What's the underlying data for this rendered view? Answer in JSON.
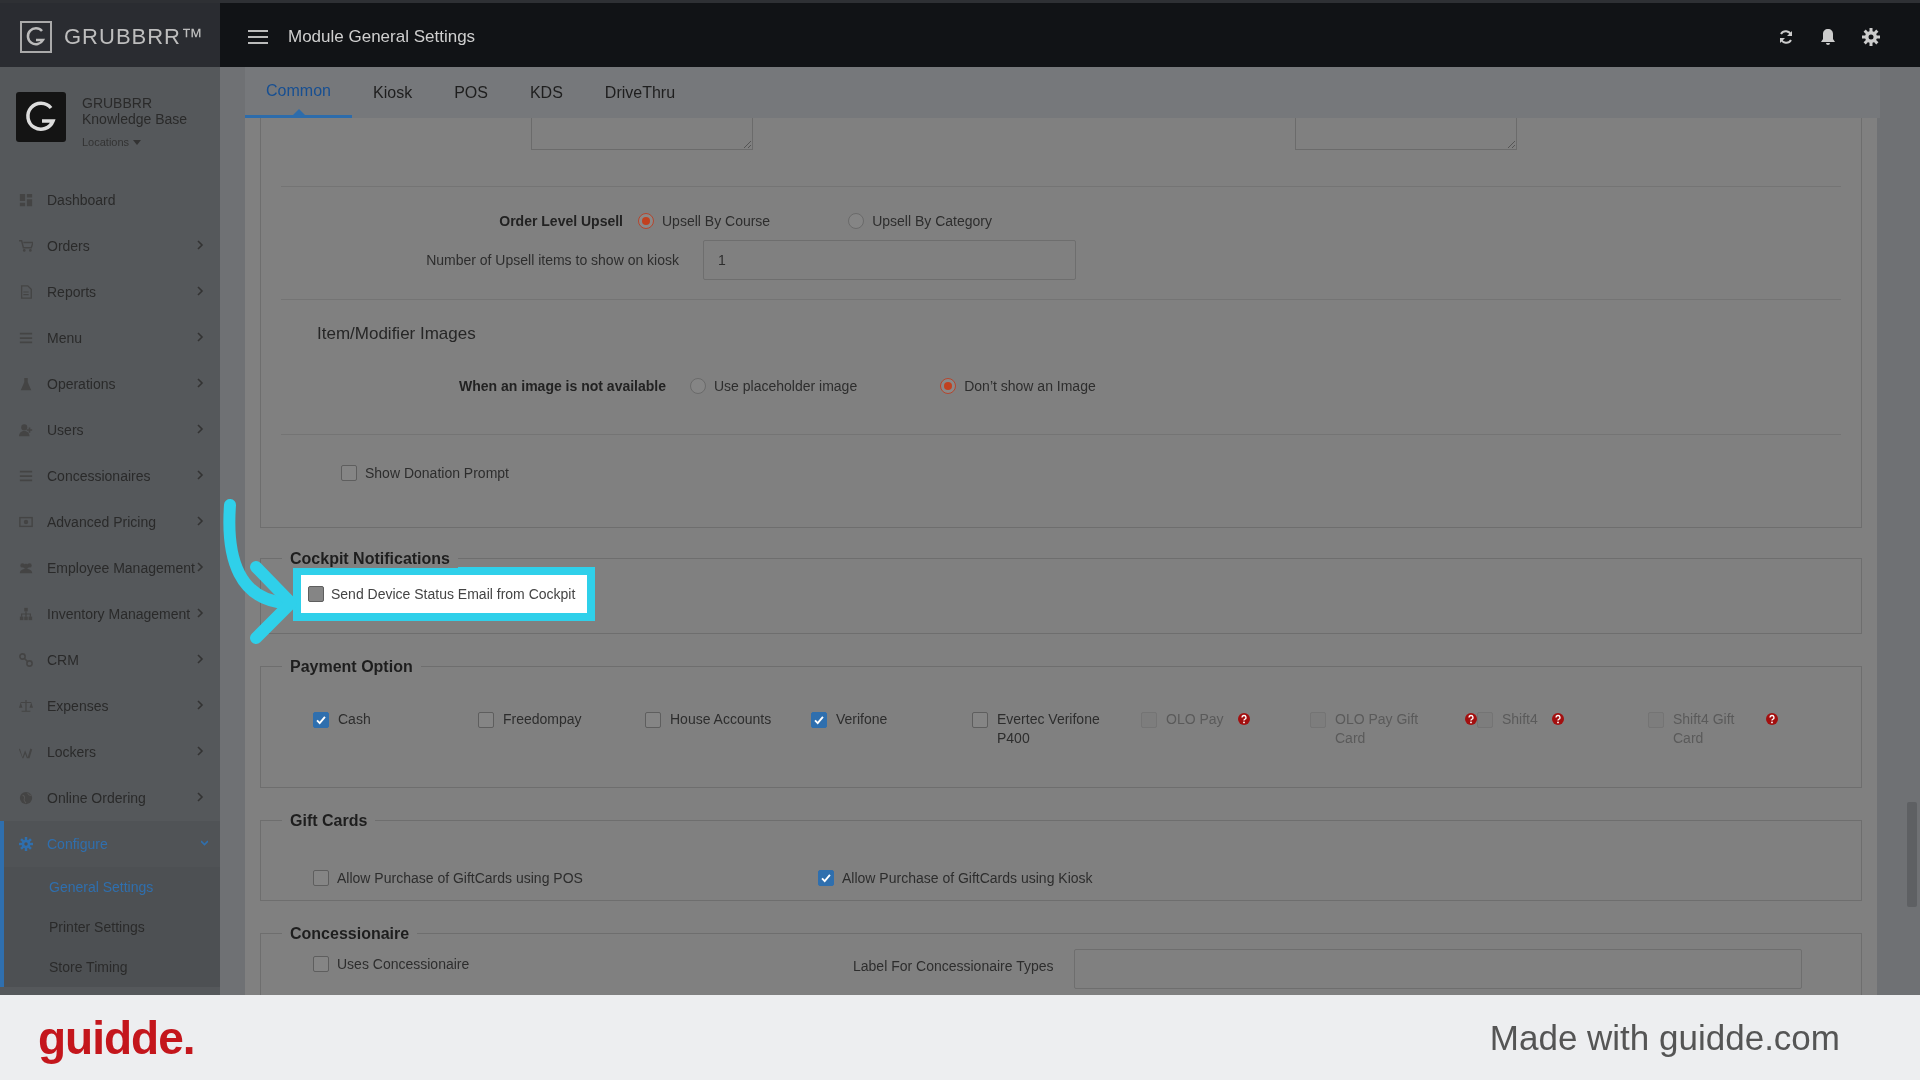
{
  "header": {
    "brand": "GRUBBRR™",
    "title": "Module General Settings"
  },
  "account": {
    "name": "GRUBBRR Knowledge Base",
    "locations": "Locations"
  },
  "sidebar": {
    "items": [
      {
        "label": "Dashboard",
        "has_children": false,
        "expanded": false
      },
      {
        "label": "Orders",
        "has_children": true,
        "expanded": false
      },
      {
        "label": "Reports",
        "has_children": true,
        "expanded": false
      },
      {
        "label": "Menu",
        "has_children": true,
        "expanded": false
      },
      {
        "label": "Operations",
        "has_children": true,
        "expanded": false
      },
      {
        "label": "Users",
        "has_children": true,
        "expanded": false
      },
      {
        "label": "Concessionaires",
        "has_children": true,
        "expanded": false
      },
      {
        "label": "Advanced Pricing",
        "has_children": true,
        "expanded": false
      },
      {
        "label": "Employee Management",
        "has_children": true,
        "expanded": false
      },
      {
        "label": "Inventory Management",
        "has_children": true,
        "expanded": false
      },
      {
        "label": "CRM",
        "has_children": true,
        "expanded": false
      },
      {
        "label": "Expenses",
        "has_children": true,
        "expanded": false
      },
      {
        "label": "Lockers",
        "has_children": true,
        "expanded": false
      },
      {
        "label": "Online Ordering",
        "has_children": true,
        "expanded": false
      },
      {
        "label": "Configure",
        "has_children": true,
        "expanded": true,
        "children": [
          {
            "label": "General Settings",
            "selected": true
          },
          {
            "label": "Printer Settings",
            "selected": false
          },
          {
            "label": "Store Timing",
            "selected": false
          }
        ]
      }
    ]
  },
  "tabs": [
    {
      "label": "Common",
      "selected": true
    },
    {
      "label": "Kiosk",
      "selected": false
    },
    {
      "label": "POS",
      "selected": false
    },
    {
      "label": "KDS",
      "selected": false
    },
    {
      "label": "DriveThru",
      "selected": false
    }
  ],
  "upsell": {
    "label": "Order Level Upsell",
    "options": [
      {
        "label": "Upsell By Course",
        "selected": true
      },
      {
        "label": "Upsell By Category",
        "selected": false
      }
    ],
    "count_label": "Number of Upsell items to show on kiosk",
    "count_value": "1"
  },
  "images": {
    "title": "Item/Modifier Images",
    "label": "When an image is not available",
    "options": [
      {
        "label": "Use placeholder image",
        "selected": false
      },
      {
        "label": "Don’t show an Image",
        "selected": true
      }
    ]
  },
  "donation": {
    "label": "Show Donation Prompt",
    "checked": false
  },
  "cockpit": {
    "title": "Cockpit Notifications",
    "options": [
      {
        "label": "Send Device Status Email from Cockpit",
        "checked": false,
        "highlighted": true
      }
    ]
  },
  "payment": {
    "title": "Payment Option",
    "options": [
      {
        "label": "Cash",
        "checked": true,
        "disabled": false,
        "help": false
      },
      {
        "label": "Freedompay",
        "checked": false,
        "disabled": false,
        "help": false
      },
      {
        "label": "House Accounts",
        "checked": false,
        "disabled": false,
        "help": false
      },
      {
        "label": "Verifone",
        "checked": true,
        "disabled": false,
        "help": false
      },
      {
        "label": "Evertec Verifone P400",
        "checked": false,
        "disabled": false,
        "help": false
      },
      {
        "label": "OLO Pay",
        "checked": false,
        "disabled": true,
        "help": true
      },
      {
        "label": "OLO Pay Gift Card",
        "checked": false,
        "disabled": true,
        "help": true
      },
      {
        "label": "Shift4",
        "checked": false,
        "disabled": true,
        "help": true
      },
      {
        "label": "Shift4 Gift Card",
        "checked": false,
        "disabled": true,
        "help": true
      }
    ]
  },
  "gift_cards": {
    "title": "Gift Cards",
    "options": [
      {
        "label": "Allow Purchase of GiftCards using POS",
        "checked": false
      },
      {
        "label": "Allow Purchase of GiftCards using Kiosk",
        "checked": true
      }
    ]
  },
  "concessionaire": {
    "title": "Concessionaire",
    "uses": {
      "label": "Uses Concessionaire",
      "checked": false
    },
    "types_label": "Label For Concessionaire Types"
  },
  "footer": {
    "brand": "guidde.",
    "text": "Made with guidde.com"
  }
}
